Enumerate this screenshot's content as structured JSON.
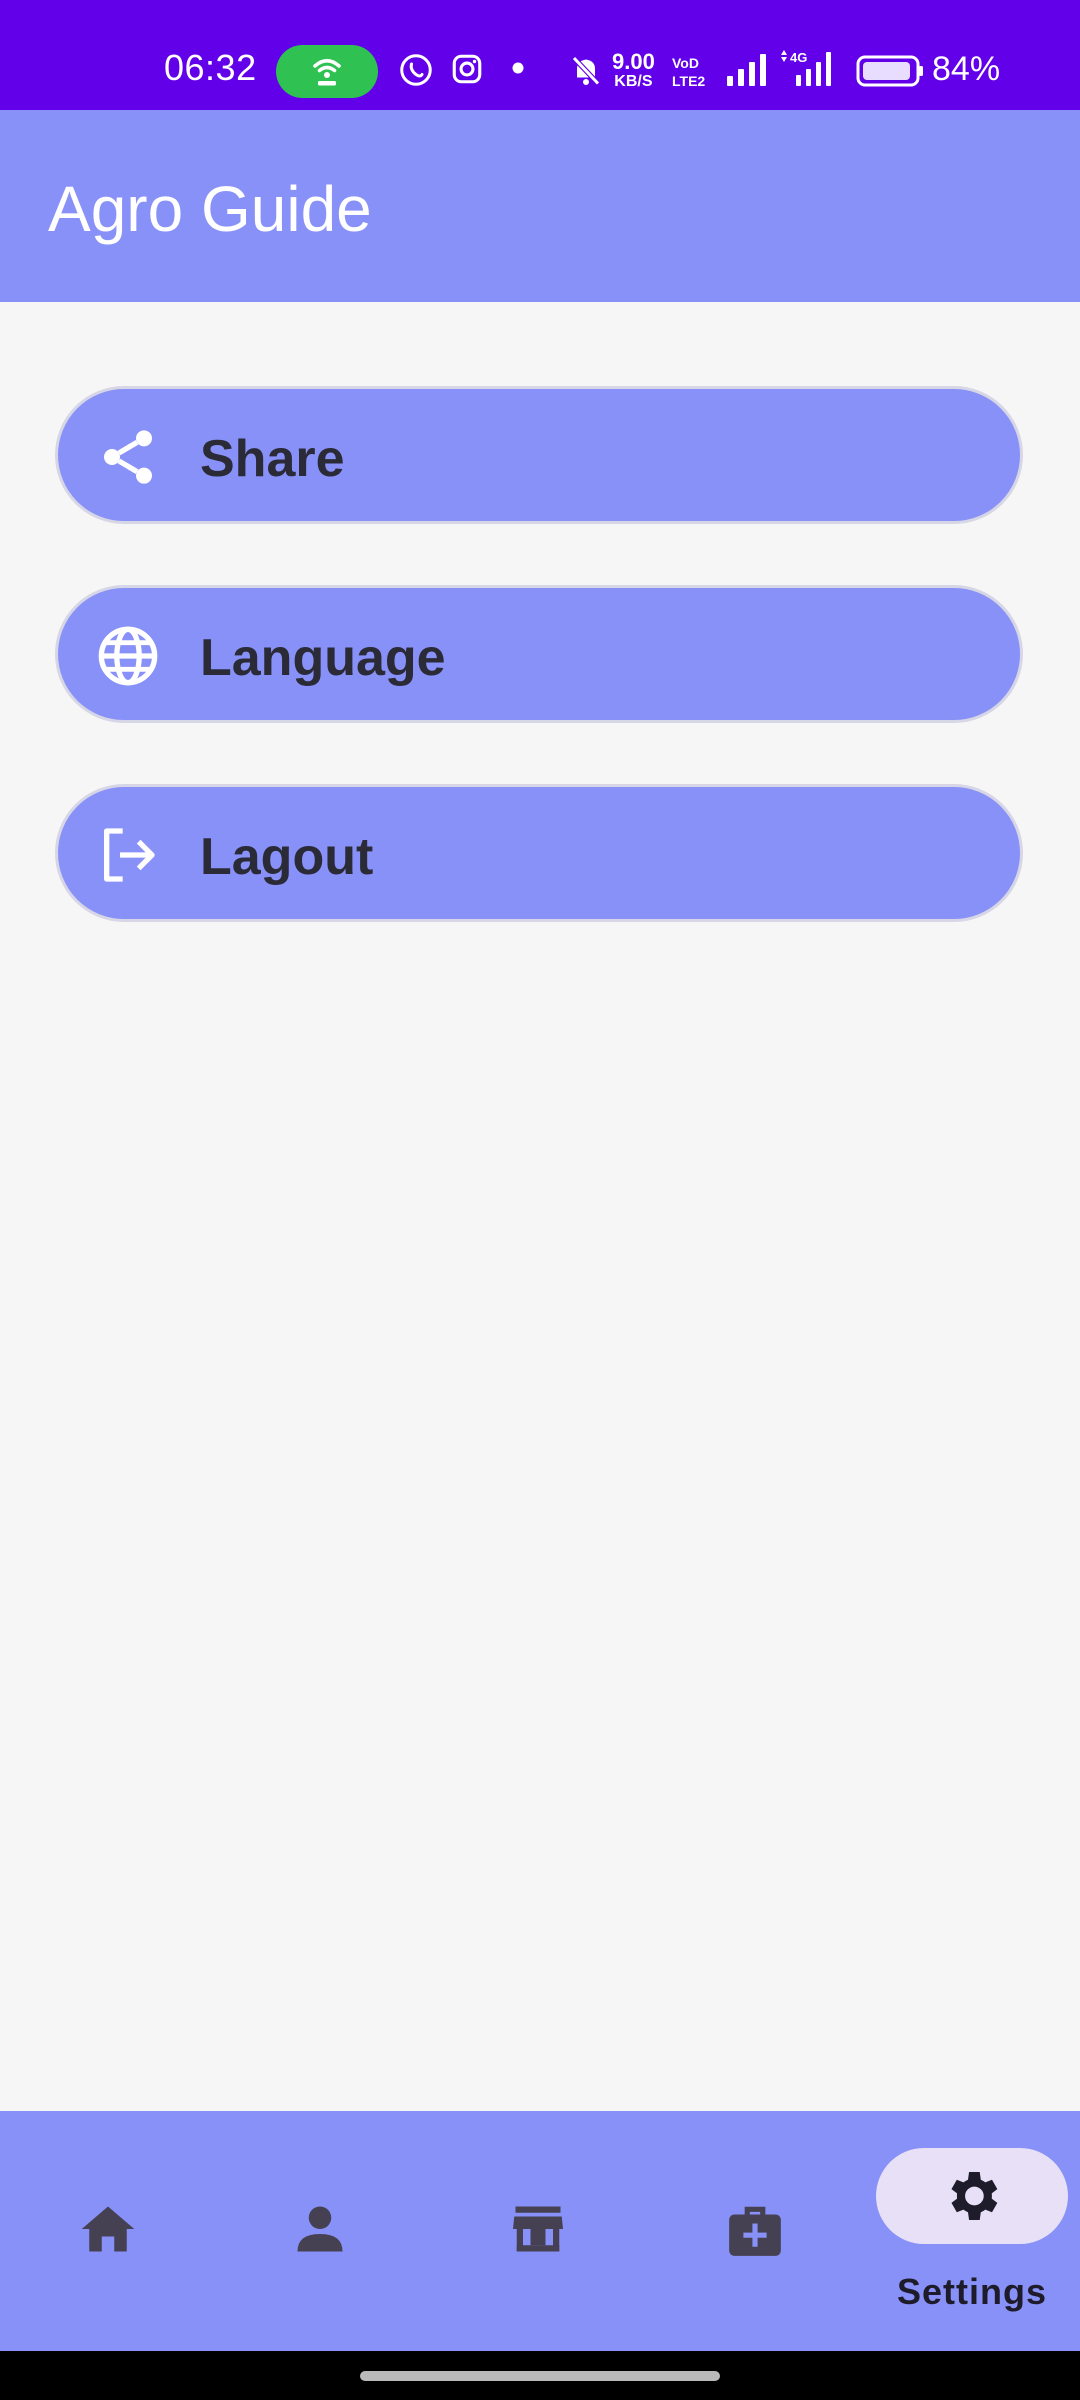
{
  "status_bar": {
    "time": "06:32",
    "net_speed": "9.00",
    "net_speed_unit": "KB/S",
    "volte_top": "VoD",
    "volte_bottom": "LTE2",
    "network_type": "4G",
    "battery": "84%",
    "battery_level": 0.84,
    "icons": [
      "hotspot-icon",
      "whatsapp-icon",
      "instagram-icon",
      "dot-icon",
      "mute-icon",
      "signal-icon",
      "signal-4g-icon",
      "battery-icon"
    ]
  },
  "app_bar": {
    "title": "Agro Guide"
  },
  "menu": {
    "items": [
      {
        "label": "Share",
        "icon": "share-icon"
      },
      {
        "label": "Language",
        "icon": "globe-icon"
      },
      {
        "label": "Lagout",
        "icon": "logout-icon"
      }
    ]
  },
  "bottom_nav": {
    "items": [
      {
        "icon": "home-icon"
      },
      {
        "icon": "person-icon"
      },
      {
        "icon": "store-icon"
      },
      {
        "icon": "medical-kit-icon"
      },
      {
        "icon": "gear-icon",
        "label": "Settings",
        "selected": true
      }
    ]
  },
  "colors": {
    "status_bar": "#6200ea",
    "primary": "#8891f7",
    "background": "#f6f6f6",
    "selected_pill": "#e7e0f7",
    "text_dark": "#2b2a37"
  }
}
